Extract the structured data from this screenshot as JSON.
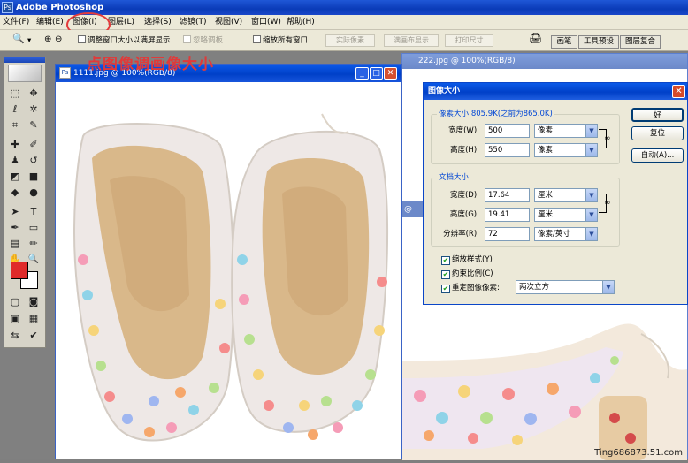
{
  "app": {
    "title": "Adobe Photoshop",
    "icon": "Ps"
  },
  "menu": [
    "文件(F)",
    "编辑(E)",
    "图像(I)",
    "图层(L)",
    "选择(S)",
    "滤镜(T)",
    "视图(V)",
    "窗口(W)",
    "帮助(H)"
  ],
  "options": {
    "resize_windows": "调整窗口大小以满屏显示",
    "ignore_palettes": "忽略调板",
    "zoom_all": "缩放所有窗口",
    "actual_pixels": "实际像素",
    "fit_screen": "满画布显示",
    "print_size": "打印尺寸"
  },
  "palette_tabs": [
    "画笔",
    "工具预设",
    "图层复合"
  ],
  "annotation": "点图像调画像大小",
  "doc1": {
    "title": "1111.jpg @ 100%(RGB/8)"
  },
  "doc2": {
    "title": "222.jpg @ 100%(RGB/8)"
  },
  "doc3": {
    "stub": "@"
  },
  "dialog": {
    "title": "图像大小",
    "close": "✕",
    "pixel_dims": {
      "label": "像素大小:805.9K(之前为865.0K)",
      "width_label": "宽度(W):",
      "width_value": "500",
      "width_unit": "像素",
      "height_label": "高度(H):",
      "height_value": "550",
      "height_unit": "像素"
    },
    "doc_size": {
      "label": "文档大小:",
      "width_label": "宽度(D):",
      "width_value": "17.64",
      "width_unit": "厘米",
      "height_label": "高度(G):",
      "height_value": "19.41",
      "height_unit": "厘米",
      "res_label": "分辨率(R):",
      "res_value": "72",
      "res_unit": "像素/英寸"
    },
    "scale_styles": "缩放样式(Y)",
    "constrain": "约束比例(C)",
    "resample": "重定图像像素:",
    "resample_method": "两次立方",
    "ok": "好",
    "reset": "复位",
    "auto": "自动(A)..."
  },
  "watermark": "Ting686873.51.com"
}
